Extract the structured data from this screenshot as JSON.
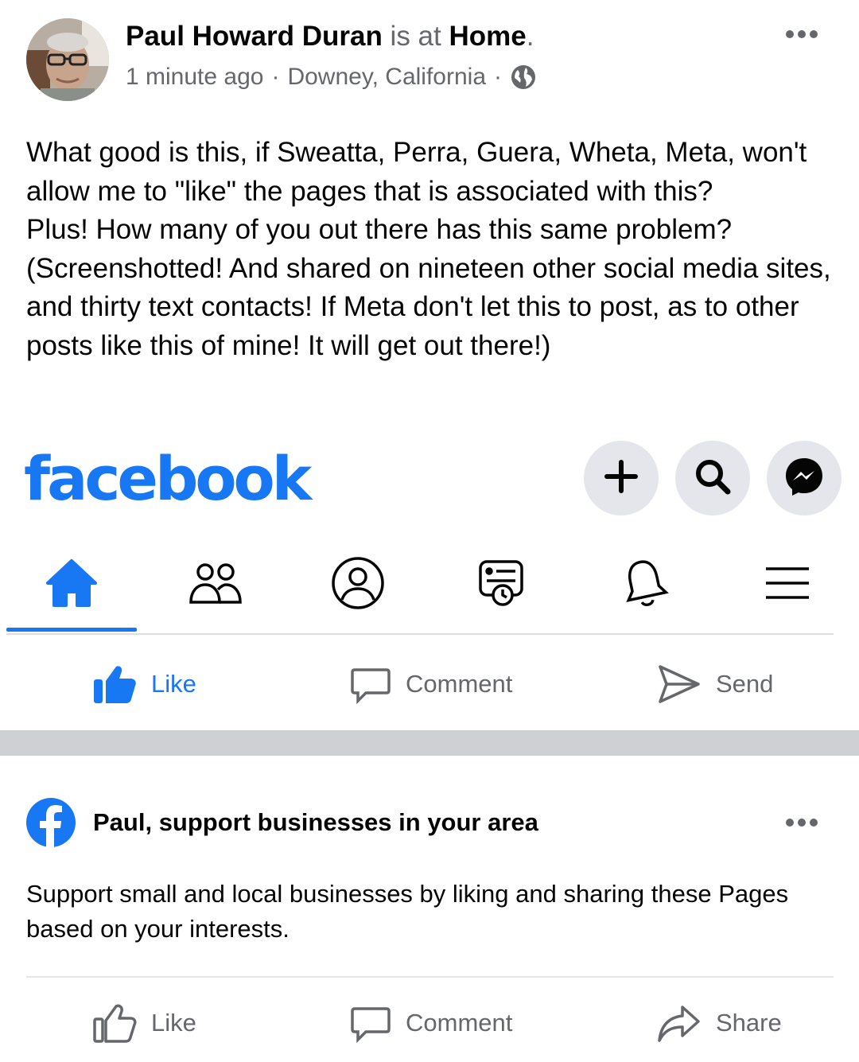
{
  "post": {
    "author": "Paul Howard Duran",
    "action_text": " is at ",
    "place": "Home",
    "period": ".",
    "time": "1 minute ago",
    "dot": "·",
    "location": "Downey, California",
    "privacy_icon": "globe-icon",
    "body": [
      "What good is this, if Sweatta, Perra, Guera, Wheta, Meta, won't allow me to \"like\" the pages that is associated with this?",
      "Plus! How many of you out there has this same problem? (Screenshotted! And shared on nineteen other social media sites, and thirty text contacts! If Meta don't let this to post, as to other posts like this of mine! It will get out there!)"
    ]
  },
  "screenshot": {
    "logo": "facebook",
    "header_buttons": [
      "plus-icon",
      "search-icon",
      "messenger-icon"
    ],
    "nav_tabs": [
      "home-icon",
      "friends-icon",
      "profile-icon",
      "feeds-icon",
      "bell-icon",
      "menu-icon"
    ],
    "actions": {
      "like": "Like",
      "comment": "Comment",
      "send": "Send"
    }
  },
  "suggestion": {
    "title": "Paul, support businesses in your area",
    "description": "Support small and local businesses by liking and sharing these Pages based on your interests.",
    "actions": {
      "like": "Like",
      "comment": "Comment",
      "share": "Share"
    }
  },
  "colors": {
    "brand_blue": "#1877f2",
    "secondary_text": "#65676b",
    "band_gray": "#ced0d4"
  }
}
